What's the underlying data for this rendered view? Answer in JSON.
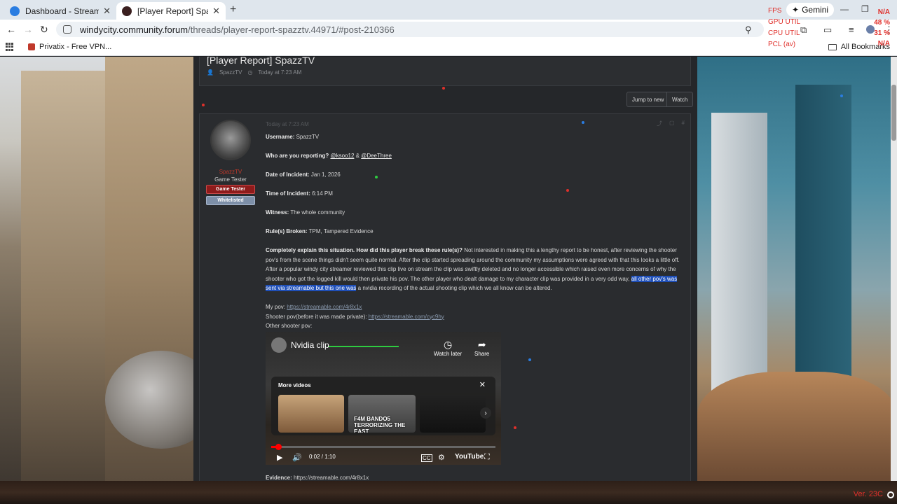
{
  "tabs": [
    {
      "title": "Dashboard - Streamable",
      "favicon_color": "#2a7de1"
    },
    {
      "title": "[Player Report] SpazzTV | Windy",
      "favicon_color": "#3a1f1f"
    }
  ],
  "toolbar": {
    "gemini_label": "Gemini",
    "url_host": "windycity.community.forum",
    "url_path": "/threads/player-report-spazztv.44971/#post-210366"
  },
  "bookmarks": {
    "item": "Privatix - Free VPN...",
    "all": "All Bookmarks"
  },
  "overlay": {
    "labels": [
      "FPS",
      "GPU UTIL",
      "CPU UTIL",
      "PCL (av)"
    ],
    "values": [
      "N/A",
      "48 %",
      "31 %",
      "N/A"
    ]
  },
  "thread": {
    "title": "[Player Report] SpazzTV",
    "author": "SpazzTV",
    "date": "Today at 7:23 AM",
    "jump_label": "Jump to new",
    "watch_label": "Watch"
  },
  "post": {
    "date": "Today at 7:23 AM",
    "user": {
      "name": "SpazzTV",
      "title": "Game Tester",
      "badge1": "Game Tester",
      "badge2": "Whitelisted"
    },
    "fields": {
      "username_label": "Username:",
      "username_value": "SpazzTV",
      "reporting_label": "Who are you reporting?",
      "reporting_user1": "@ksoo12",
      "reporting_amp": "&",
      "reporting_user2": "@DeeThree",
      "date_label": "Date of Incident:",
      "date_value": "Jan 1, 2026",
      "time_label": "Time of Incident:",
      "time_value": "6:14 PM",
      "witness_label": "Witness:",
      "witness_value": "The whole community",
      "rules_label": "Rule(s) Broken:",
      "rules_value": "TPM, Tampered Evidence",
      "explain_label": "Completely explain this situation. How did this player break these rule(s)?",
      "explain_text": "Not interested in making this a lengthy report to be honest, after reviewing the shooter pov's from the scene things didn't seem quite normal. After the clip started spreading around the community my assumptions were agreed with that this looks a little off. After a popular windy city streamer reviewed this clip live on stream the clip was swiftly deleted and no longer accessible which raised even more concerns of why the shooter who got the logged kill would then private his pov. The other player who dealt damage to my character clip was provided in a very odd way,",
      "explain_highlight": "all other pov's was sent via streamable but this one was",
      "explain_tail": "a nvidia recording of the actual shooting clip which we all know can be altered.",
      "mypov_label": "My pov:",
      "mypov_link": "https://streamable.com/4r8x1x",
      "shooter_label": "Shooter pov(before it was made private):",
      "shooter_link": "https://streamable.com/cyc9hy",
      "other_label": "Other shooter pov:",
      "evidence_label": "Evidence:",
      "evidence_link": "https://streamable.com/4r8x1x"
    },
    "video": {
      "title": "Nvidia clip",
      "watch_later": "Watch later",
      "share": "Share",
      "more_videos": "More videos",
      "thumb_caption": "F4M BANDO5 TERRORIZING THE EAST",
      "time": "0:02 / 1:10",
      "brand": "YouTube",
      "progress": 0.03
    }
  },
  "footer": {
    "version": "Ver. 23C"
  }
}
